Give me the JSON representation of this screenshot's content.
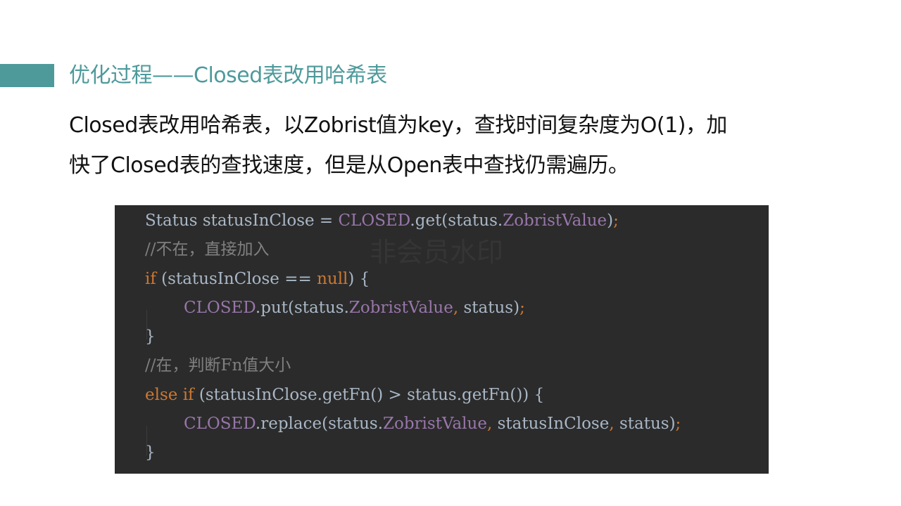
{
  "slide": {
    "title": "优化过程——Closed表改用哈希表",
    "body_lines": [
      "Closed表改用哈希表，以Zobrist值为key，查找时间复杂度为O(1)，加",
      "快了Closed表的查找速度，但是从Open表中查找仍需遍历。"
    ]
  },
  "code": {
    "watermark": "非会员水印",
    "lines": [
      {
        "indent": 0,
        "tokens": [
          {
            "t": "Status statusInClose = ",
            "k": "plain"
          },
          {
            "t": "CLOSED",
            "k": "field"
          },
          {
            "t": ".get(status.",
            "k": "plain"
          },
          {
            "t": "ZobristValue",
            "k": "field"
          },
          {
            "t": ")",
            "k": "plain"
          },
          {
            "t": ";",
            "k": "kw"
          }
        ]
      },
      {
        "indent": 0,
        "tokens": [
          {
            "t": "//不在，直接加入",
            "k": "comment"
          }
        ]
      },
      {
        "indent": 0,
        "tokens": [
          {
            "t": "if",
            "k": "kw"
          },
          {
            "t": " (statusInClose == ",
            "k": "plain"
          },
          {
            "t": "null",
            "k": "kw"
          },
          {
            "t": ") {",
            "k": "plain"
          }
        ]
      },
      {
        "indent": 1,
        "tokens": [
          {
            "t": "CLOSED",
            "k": "field"
          },
          {
            "t": ".put(status.",
            "k": "plain"
          },
          {
            "t": "ZobristValue",
            "k": "field"
          },
          {
            "t": ", ",
            "k": "kw"
          },
          {
            "t": "status)",
            "k": "plain"
          },
          {
            "t": ";",
            "k": "kw"
          }
        ]
      },
      {
        "indent": 0,
        "tokens": [
          {
            "t": "}",
            "k": "plain"
          }
        ]
      },
      {
        "indent": 0,
        "tokens": [
          {
            "t": "//在，判断Fn值大小",
            "k": "comment"
          }
        ]
      },
      {
        "indent": 0,
        "tokens": [
          {
            "t": "else if",
            "k": "kw"
          },
          {
            "t": " (statusInClose.getFn() > status.getFn()) {",
            "k": "plain"
          }
        ]
      },
      {
        "indent": 1,
        "tokens": [
          {
            "t": "CLOSED",
            "k": "field"
          },
          {
            "t": ".replace(status.",
            "k": "plain"
          },
          {
            "t": "ZobristValue",
            "k": "field"
          },
          {
            "t": ", ",
            "k": "kw"
          },
          {
            "t": "statusInClose",
            "k": "plain"
          },
          {
            "t": ", ",
            "k": "kw"
          },
          {
            "t": "status)",
            "k": "plain"
          },
          {
            "t": ";",
            "k": "kw"
          }
        ]
      },
      {
        "indent": 0,
        "tokens": [
          {
            "t": "}",
            "k": "plain"
          }
        ]
      }
    ]
  }
}
